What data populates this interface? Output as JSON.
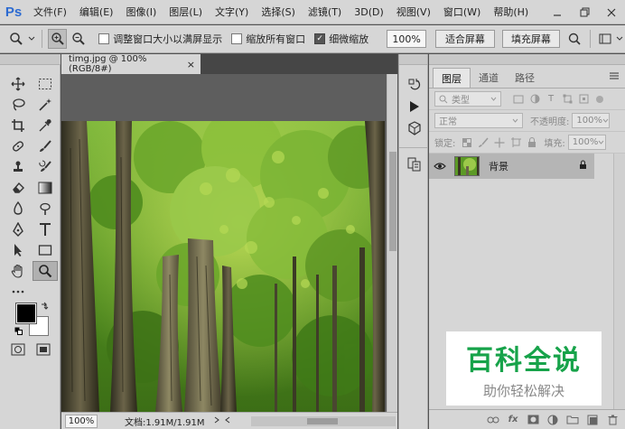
{
  "app": {
    "logo": "Ps"
  },
  "menu": [
    "文件(F)",
    "编辑(E)",
    "图像(I)",
    "图层(L)",
    "文字(Y)",
    "选择(S)",
    "滤镜(T)",
    "3D(D)",
    "视图(V)",
    "窗口(W)",
    "帮助(H)"
  ],
  "options": {
    "resize_windows": "调整窗口大小以满屏显示",
    "zoom_all": "缩放所有窗口",
    "scrubby_zoom": "细微缩放",
    "zoom_value": "100%",
    "fit_screen": "适合屏幕",
    "fill_screen": "填充屏幕"
  },
  "document": {
    "tab_title": "timg.jpg @ 100%(RGB/8#)"
  },
  "status": {
    "zoom": "100%",
    "doc_info": "文档:1.91M/1.91M"
  },
  "layers_panel": {
    "tabs": [
      "图层",
      "通道",
      "路径"
    ],
    "filter_kind": "类型",
    "blend_mode": "正常",
    "opacity_label": "不透明度:",
    "opacity_value": "100%",
    "lock_label": "锁定:",
    "fill_label": "填充:",
    "fill_value": "100%",
    "layer_name": "背景"
  },
  "watermark": {
    "title": "百科全说",
    "subtitle": "助你轻松解决"
  }
}
